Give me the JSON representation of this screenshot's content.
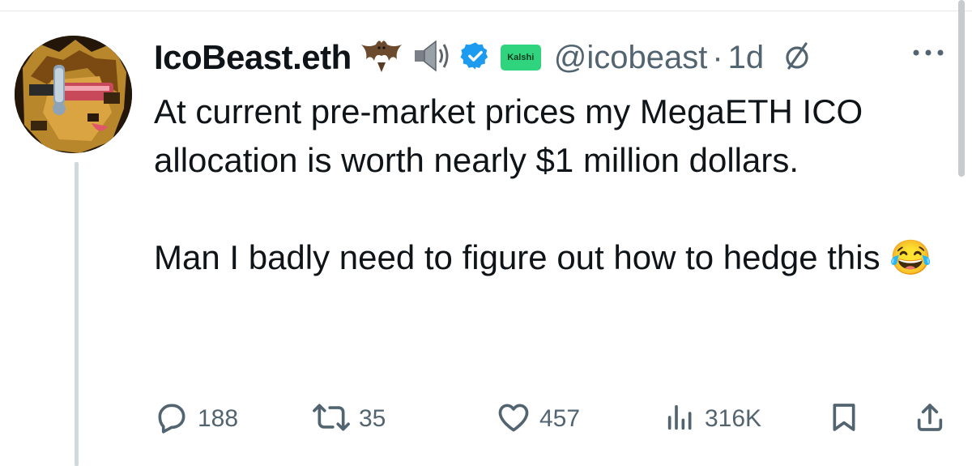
{
  "tweet": {
    "display_name": "IcoBeast.eth",
    "handle": "@icobeast",
    "separator": "·",
    "time": "1d",
    "badge_label": "Kalshi",
    "text_para1": "At current pre-market prices my MegaETH ICO allocation is worth nearly $1 million dollars.",
    "text_para2": "Man I badly need to figure out how to hedge this",
    "emoji": "😂"
  },
  "actions": {
    "replies": "188",
    "reposts": "35",
    "likes": "457",
    "views": "316K"
  },
  "colors": {
    "text": "#0f1419",
    "secondary": "#536471",
    "verified": "#1d9bf0",
    "kalshi_badge": "#31d47e",
    "thread_line": "#cfd9de"
  },
  "icons": [
    "bat-emoji-icon",
    "speaker-emoji-icon",
    "verified-icon",
    "grok-icon",
    "more-icon",
    "reply-icon",
    "repost-icon",
    "like-icon",
    "views-icon",
    "bookmark-icon",
    "share-icon"
  ]
}
